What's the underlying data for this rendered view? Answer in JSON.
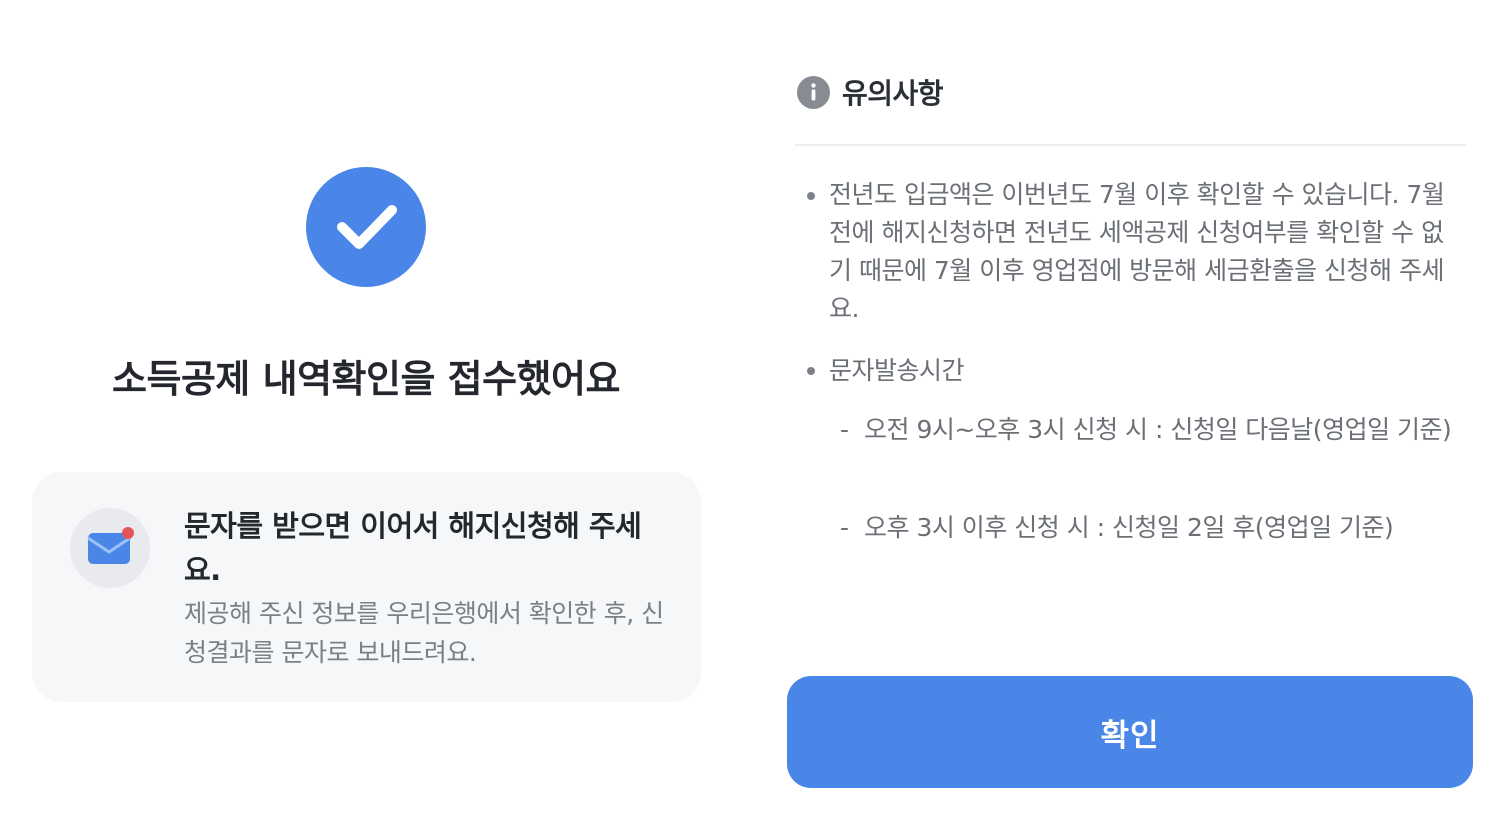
{
  "status": {
    "icon": "check-icon",
    "title": "소득공제 내역확인을 접수했어요"
  },
  "card": {
    "icon": "mail-icon",
    "title": "문자를 받으면 이어서 해지신청해 주세요.",
    "description": "제공해 주신 정보를 우리은행에서 확인한 후, 신청결과를 문자로 보내드려요."
  },
  "notice": {
    "icon": "info-icon",
    "title": "유의사항",
    "items": [
      "전년도 입금액은 이번년도 7월 이후 확인할 수 있습니다. 7월 전에 해지신청하면 전년도 세액공제 신청여부를 확인할 수 없기 때문에 7월 이후 영업점에 방문해 세금환출을 신청해 주세요.",
      "문자발송시간"
    ],
    "sub_items": [
      "오전 9시~오후 3시 신청 시 : 신청일 다음날(영업일 기준)",
      "오후 3시 이후 신청 시 : 신청일 2일 후(영업일 기준)"
    ],
    "dash": "-"
  },
  "footer": {
    "confirm_label": "확인"
  },
  "colors": {
    "accent": "#4a86e8",
    "card_background": "#f6f7f8",
    "notification_dot": "#e4545c"
  }
}
